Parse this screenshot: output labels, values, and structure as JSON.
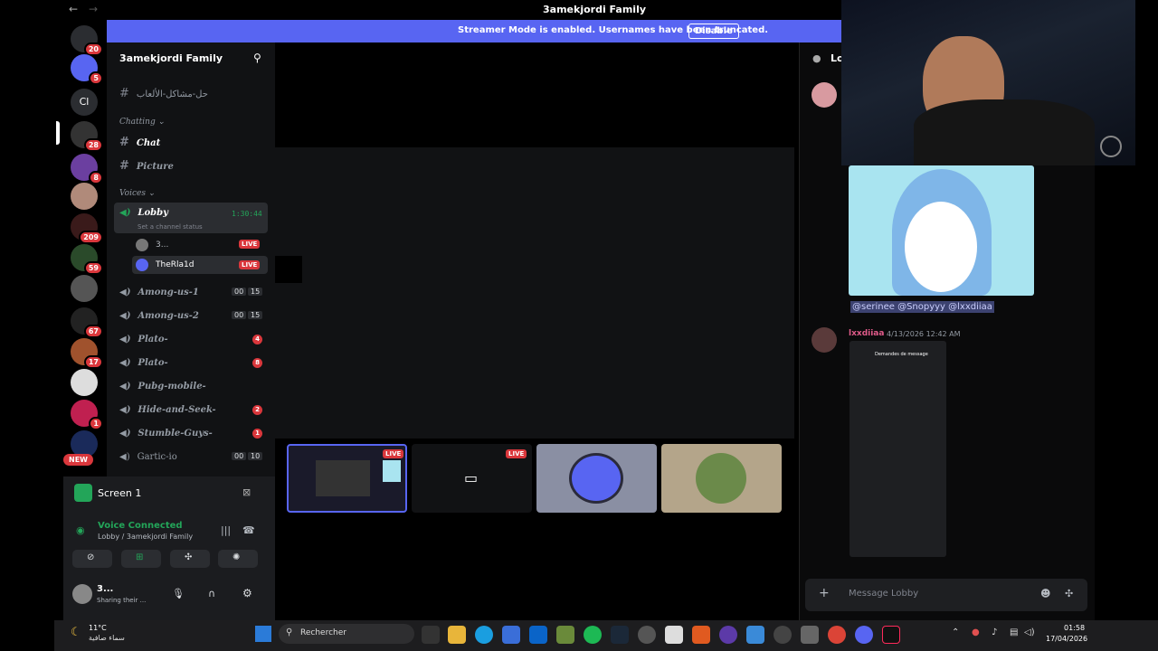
{
  "window": {
    "title": "3amekjordi Family"
  },
  "banner": {
    "message": "Streamer Mode is enabled. Usernames have been truncated.",
    "button": "Disable"
  },
  "server": {
    "name": "3amekjordi Family"
  },
  "guild_badges": [
    "20",
    "5",
    "28",
    "8",
    "209",
    "59",
    "67",
    "17",
    "1"
  ],
  "guild_dm_label": "Cl",
  "new_badge": "NEW",
  "channels": {
    "top": "حل-مشاكل-الألعاب",
    "cat_chatting": "Chatting",
    "chat": "Chat",
    "picture": "Picture",
    "cat_voices": "Voices",
    "lobby": "Lobby",
    "lobby_timer": "1:30:44",
    "lobby_status": "Set a channel status",
    "user1": "3...",
    "user2": "TheRla1d",
    "live": "LIVE",
    "among1": "Among-us-1",
    "among2": "Among-us-2",
    "among_count_a": "00",
    "among_count_b": "15",
    "plato1": "Plato-",
    "plato2": "Plato-",
    "pubg": "Pubg-mobile-",
    "hide": "Hide-and-Seek-",
    "stumble": "Stumble-Guys-",
    "gartic": "Gartic-io",
    "gartic_a": "00",
    "gartic_b": "10",
    "badge4": "4",
    "badge8": "8",
    "badge2": "2",
    "badge1": "1"
  },
  "screen_panel": {
    "label": "Screen 1"
  },
  "voice": {
    "status": "Voice Connected",
    "location": "Lobby / 3amekjordi Family"
  },
  "user": {
    "name": "3...",
    "status": "Sharing their ..."
  },
  "chat": {
    "header": "Lo",
    "mentions": "@serinee @Snopyyy @lxxdiiaa",
    "author": "lxxdiiaa",
    "timestamp": "4/13/2026 12:42 AM",
    "phone_title": "Demandes de message",
    "input_placeholder": "Message Lobby"
  },
  "taskbar": {
    "weather_temp": "11°C",
    "weather_text": "سماء صافية",
    "search": "Rechercher",
    "time": "01:58",
    "date": "17/04/2026"
  },
  "colors": {
    "blurple": "#5865f2",
    "green": "#23a559",
    "red": "#da373c",
    "bg": "#111214"
  }
}
